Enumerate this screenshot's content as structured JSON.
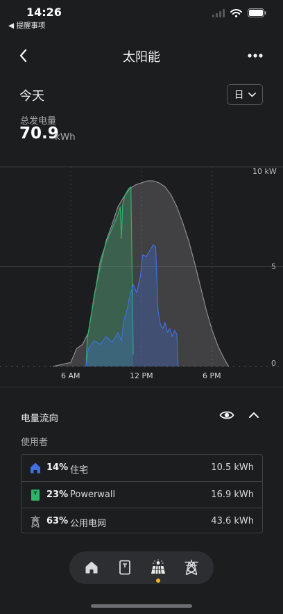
{
  "status_bar": {
    "time": "14:26",
    "back_app": "◀ 提醒事项",
    "icons": [
      "signal-icon",
      "wifi-icon",
      "battery-icon"
    ]
  },
  "nav": {
    "title": "太阳能",
    "back_icon": "chevron-left-icon",
    "more_icon": "more-icon"
  },
  "summary": {
    "day_title": "今天",
    "period_selector": "日",
    "generation_label": "总发电量",
    "generation_value": "70.9",
    "generation_unit": "kWh"
  },
  "chart_data": {
    "type": "area",
    "y_tick_labels": [
      "10 kW",
      "5",
      "0"
    ],
    "x_tick_labels": [
      "6 AM",
      "12 PM",
      "6 PM"
    ],
    "xlim": [
      0,
      24
    ],
    "ylim": [
      0,
      10
    ],
    "series": [
      {
        "color": "#8e8e90",
        "x": [
          4.5,
          6.0,
          6.5,
          7.0,
          7.5,
          8.0,
          8.5,
          9.0,
          9.5,
          10.0,
          10.5,
          11.0,
          11.5,
          12.0,
          12.5,
          13.0,
          13.5,
          14.0,
          14.5,
          15.0,
          15.5,
          16.0,
          16.5,
          17.0,
          17.5,
          18.0,
          18.5,
          19.0,
          19.4
        ],
        "y": [
          0.0,
          0.2,
          0.9,
          1.1,
          1.7,
          3.6,
          5.0,
          6.3,
          7.1,
          8.0,
          8.5,
          8.9,
          9.1,
          9.2,
          9.3,
          9.3,
          9.2,
          9.0,
          8.6,
          8.0,
          7.2,
          6.3,
          5.2,
          4.0,
          2.8,
          1.8,
          1.0,
          0.4,
          0.0
        ]
      },
      {
        "color": "#2fb36b",
        "x": [
          7.3,
          7.4,
          8.0,
          8.5,
          9.0,
          9.5,
          10.0,
          10.2,
          10.3,
          10.4,
          10.6,
          10.9,
          11.1,
          11.3
        ],
        "y": [
          0.0,
          1.4,
          3.5,
          5.3,
          6.2,
          6.9,
          7.6,
          8.0,
          6.4,
          8.1,
          8.6,
          8.9,
          9.0,
          0.6
        ]
      },
      {
        "color": "#3f6fe0",
        "x": [
          7.3,
          7.5,
          8.0,
          8.5,
          9.0,
          9.5,
          10.0,
          10.3,
          10.5,
          10.8,
          11.0,
          11.3,
          11.6,
          11.9,
          12.1,
          12.4,
          12.7,
          13.0,
          13.2,
          13.4,
          13.6,
          13.8,
          14.0,
          14.2,
          14.4,
          14.6,
          14.8,
          15.0,
          15.1
        ],
        "y": [
          0.0,
          0.9,
          1.3,
          1.1,
          1.5,
          1.2,
          1.7,
          1.3,
          2.3,
          2.9,
          3.5,
          4.1,
          3.7,
          4.5,
          5.6,
          5.5,
          5.8,
          6.1,
          6.0,
          2.8,
          2.1,
          1.9,
          2.2,
          1.7,
          1.9,
          1.5,
          1.8,
          1.6,
          0.0
        ]
      }
    ]
  },
  "energy_flow": {
    "title": "电量流向",
    "users_label": "使用者",
    "rows": [
      {
        "icon": "home-icon",
        "percent": "14%",
        "name": "住宅",
        "value": "10.5 kWh",
        "color": "#3f6fe0"
      },
      {
        "icon": "powerwall-icon",
        "percent": "23%",
        "name": "Powerwall",
        "value": "16.9 kWh",
        "color": "#2fb36b"
      },
      {
        "icon": "grid-tower-icon",
        "percent": "63%",
        "name": "公用电网",
        "value": "43.6 kWh",
        "color": "#9a9c9f"
      }
    ]
  },
  "tab_bar": {
    "tabs": [
      "home-icon",
      "powerwall-icon",
      "solar-panel-icon",
      "grid-tower-icon"
    ],
    "active_tab": "solar-panel-icon",
    "active_color": "#f5b818"
  }
}
